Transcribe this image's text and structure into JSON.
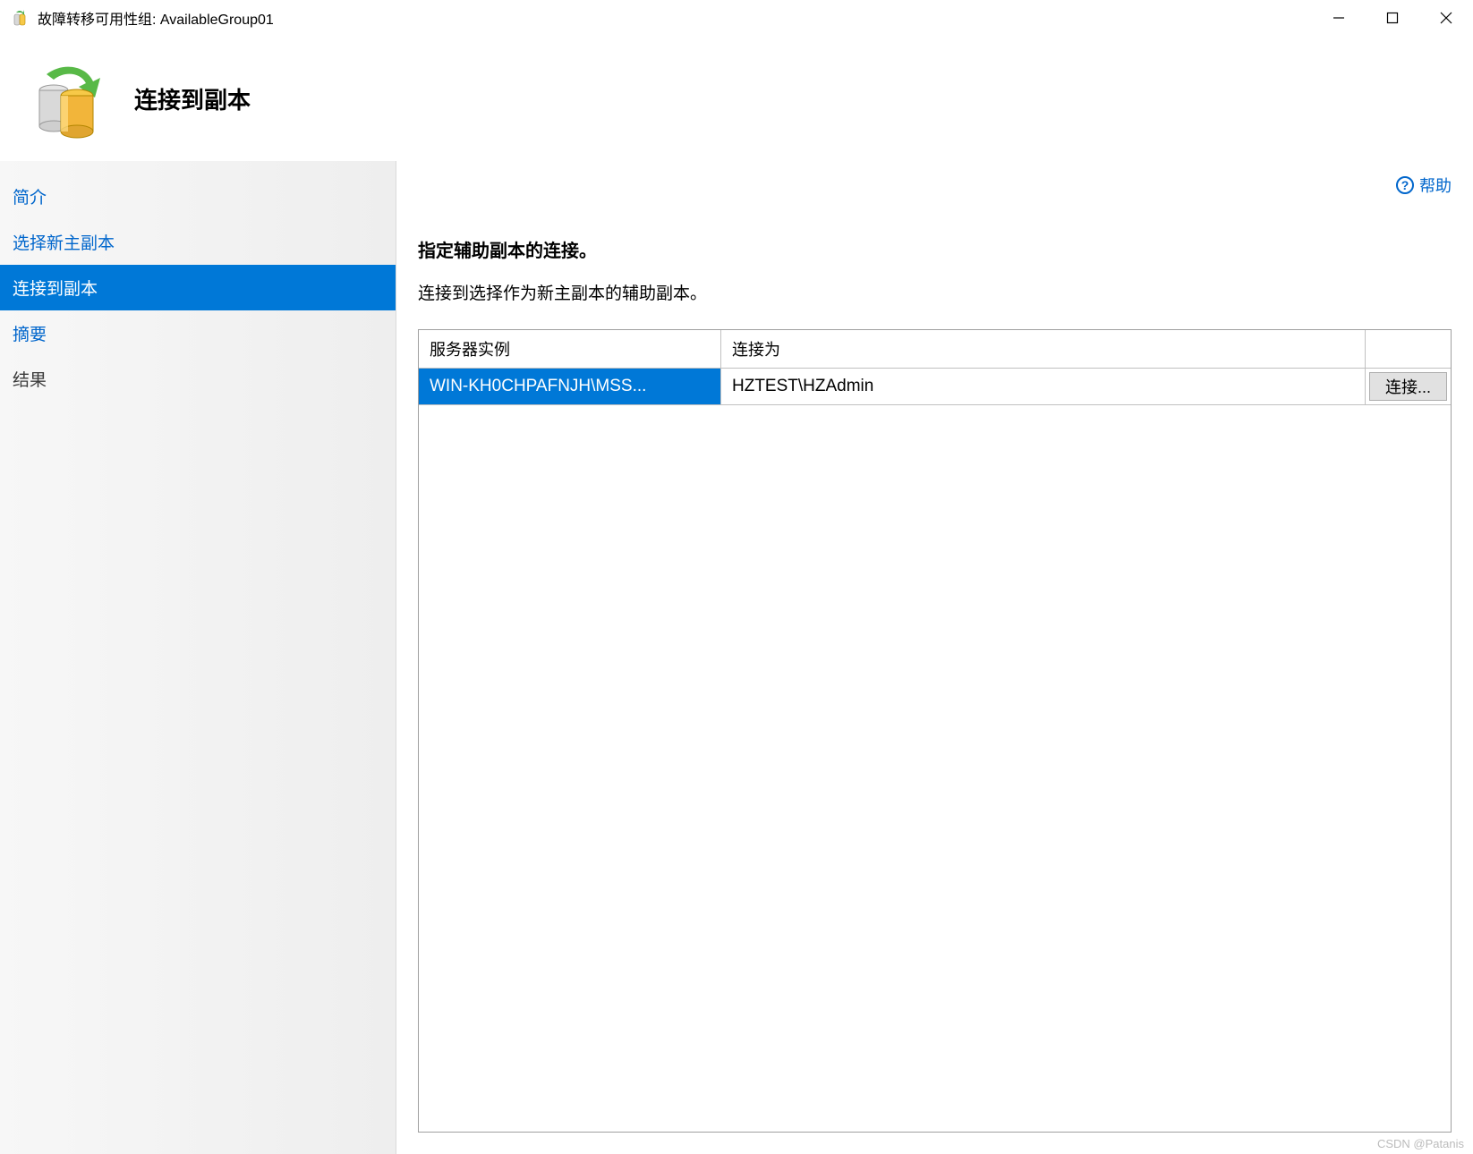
{
  "window": {
    "title": "故障转移可用性组: AvailableGroup01"
  },
  "header": {
    "page_title": "连接到副本"
  },
  "sidebar": {
    "items": [
      {
        "label": "简介"
      },
      {
        "label": "选择新主副本"
      },
      {
        "label": "连接到副本"
      },
      {
        "label": "摘要"
      },
      {
        "label": "结果"
      }
    ]
  },
  "main": {
    "help_label": "帮助",
    "section_heading": "指定辅助副本的连接。",
    "section_desc": "连接到选择作为新主副本的辅助副本。",
    "grid": {
      "columns": {
        "server_instance": "服务器实例",
        "connected_as": "连接为"
      },
      "rows": [
        {
          "server_instance": "WIN-KH0CHPAFNJH\\MSS...",
          "connected_as": "HZTEST\\HZAdmin",
          "connect_button": "连接..."
        }
      ]
    }
  },
  "watermark": "CSDN @Patanis"
}
